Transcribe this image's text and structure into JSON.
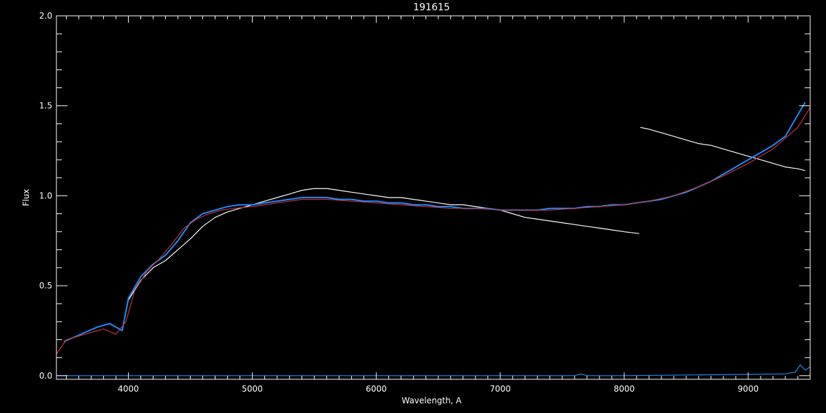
{
  "chart_data": {
    "type": "line",
    "title": "191615",
    "xlabel": "Wavelength, A",
    "ylabel": "Flux",
    "xlim": [
      3420,
      9500
    ],
    "ylim": [
      -0.02,
      2.0
    ],
    "xticks": [
      4000,
      5000,
      6000,
      7000,
      8000,
      9000
    ],
    "xtick_labels": [
      "4000",
      "5000",
      "6000",
      "7000",
      "8000",
      "9000"
    ],
    "yticks": [
      0.0,
      0.5,
      1.0,
      1.5,
      2.0
    ],
    "ytick_labels": [
      "0.0",
      "0.5",
      "1.0",
      "1.5",
      "2.0"
    ],
    "grid": false,
    "colors": {
      "background": "#000000",
      "axes": "#ffffff",
      "white_spectrum": "#ffffff",
      "blue_spectrum": "#1e8cff",
      "model": "#c8323c"
    },
    "series": [
      {
        "color": "#ffffff",
        "segments": [
          {
            "x": [
              3480,
              3550,
              3650,
              3750,
              3850,
              3950,
              4000,
              4100,
              4200,
              4300,
              4400,
              4500,
              4600,
              4700,
              4800,
              4900,
              5000,
              5100,
              5200,
              5300,
              5400,
              5500,
              5600,
              5700,
              5800,
              5900,
              6000,
              6100,
              6200,
              6300,
              6400,
              6500,
              6600,
              6700,
              6800,
              6900,
              7000,
              7100,
              7200,
              7300,
              7400,
              7500,
              7600,
              7700,
              7800,
              7900,
              8000,
              8120
            ],
            "y": [
              0.19,
              0.21,
              0.24,
              0.27,
              0.29,
              0.25,
              0.42,
              0.53,
              0.6,
              0.64,
              0.7,
              0.76,
              0.83,
              0.88,
              0.91,
              0.93,
              0.95,
              0.97,
              0.99,
              1.01,
              1.03,
              1.04,
              1.04,
              1.03,
              1.02,
              1.01,
              1.0,
              0.99,
              0.99,
              0.98,
              0.97,
              0.96,
              0.95,
              0.95,
              0.94,
              0.93,
              0.92,
              0.9,
              0.88,
              0.87,
              0.86,
              0.85,
              0.84,
              0.83,
              0.82,
              0.81,
              0.8,
              0.79
            ]
          },
          {
            "x": [
              8130,
              8200,
              8300,
              8400,
              8500,
              8600,
              8700,
              8800,
              8900,
              9000,
              9100,
              9200,
              9300,
              9400,
              9460
            ],
            "y": [
              1.38,
              1.37,
              1.35,
              1.33,
              1.31,
              1.29,
              1.28,
              1.26,
              1.24,
              1.22,
              1.2,
              1.18,
              1.16,
              1.15,
              1.14
            ]
          }
        ]
      },
      {
        "color": "#1e8cff",
        "segments": [
          {
            "x": [
              3480,
              3550,
              3650,
              3750,
              3850,
              3950,
              4000,
              4100,
              4200,
              4300,
              4400,
              4500,
              4600,
              4700,
              4800,
              4900,
              5000,
              5100,
              5200,
              5300,
              5400,
              5500,
              5600,
              5700,
              5800,
              5900,
              6000,
              6100,
              6200,
              6300,
              6400,
              6500,
              6600,
              6700,
              6800,
              6900,
              7000,
              7100,
              7200,
              7300,
              7400,
              7500,
              7600,
              7700,
              7800,
              7900,
              8000,
              8100,
              8200,
              8300,
              8400,
              8500,
              8600,
              8700,
              8800,
              8900,
              9000,
              9100,
              9200,
              9300,
              9400,
              9460
            ],
            "y": [
              0.19,
              0.21,
              0.24,
              0.27,
              0.29,
              0.25,
              0.43,
              0.55,
              0.62,
              0.67,
              0.75,
              0.85,
              0.9,
              0.92,
              0.94,
              0.95,
              0.95,
              0.96,
              0.97,
              0.98,
              0.99,
              0.99,
              0.99,
              0.98,
              0.98,
              0.97,
              0.97,
              0.96,
              0.96,
              0.95,
              0.95,
              0.94,
              0.94,
              0.93,
              0.93,
              0.93,
              0.92,
              0.92,
              0.92,
              0.92,
              0.93,
              0.93,
              0.93,
              0.94,
              0.94,
              0.95,
              0.95,
              0.96,
              0.97,
              0.98,
              1.0,
              1.02,
              1.05,
              1.08,
              1.12,
              1.16,
              1.2,
              1.24,
              1.28,
              1.33,
              1.45,
              1.52
            ]
          }
        ]
      },
      {
        "color": "#c8323c",
        "segments": [
          {
            "x": [
              3420,
              3500,
              3600,
              3700,
              3800,
              3900,
              3980,
              4050,
              4150,
              4250,
              4350,
              4450,
              4550,
              4650,
              4750,
              4850,
              5000,
              5200,
              5400,
              5600,
              5800,
              6000,
              6200,
              6400,
              6600,
              6800,
              7000,
              7200,
              7400,
              7600,
              7800,
              8000,
              8200,
              8400,
              8600,
              8800,
              9000,
              9200,
              9400,
              9500
            ],
            "y": [
              0.12,
              0.2,
              0.22,
              0.24,
              0.26,
              0.23,
              0.3,
              0.47,
              0.58,
              0.65,
              0.73,
              0.82,
              0.87,
              0.9,
              0.92,
              0.93,
              0.94,
              0.96,
              0.98,
              0.98,
              0.97,
              0.96,
              0.95,
              0.94,
              0.93,
              0.93,
              0.92,
              0.92,
              0.92,
              0.93,
              0.94,
              0.95,
              0.97,
              1.0,
              1.05,
              1.11,
              1.18,
              1.26,
              1.38,
              1.49
            ]
          }
        ]
      },
      {
        "color": "#1e8cff",
        "segments": [
          {
            "x": [
              3420,
              7600,
              7650,
              7700,
              8000,
              9300,
              9380,
              9420,
              9460,
              9500
            ],
            "y": [
              0.0,
              0.0,
              0.01,
              0.0,
              0.0,
              0.01,
              0.02,
              0.06,
              0.03,
              0.05
            ]
          }
        ]
      }
    ]
  }
}
